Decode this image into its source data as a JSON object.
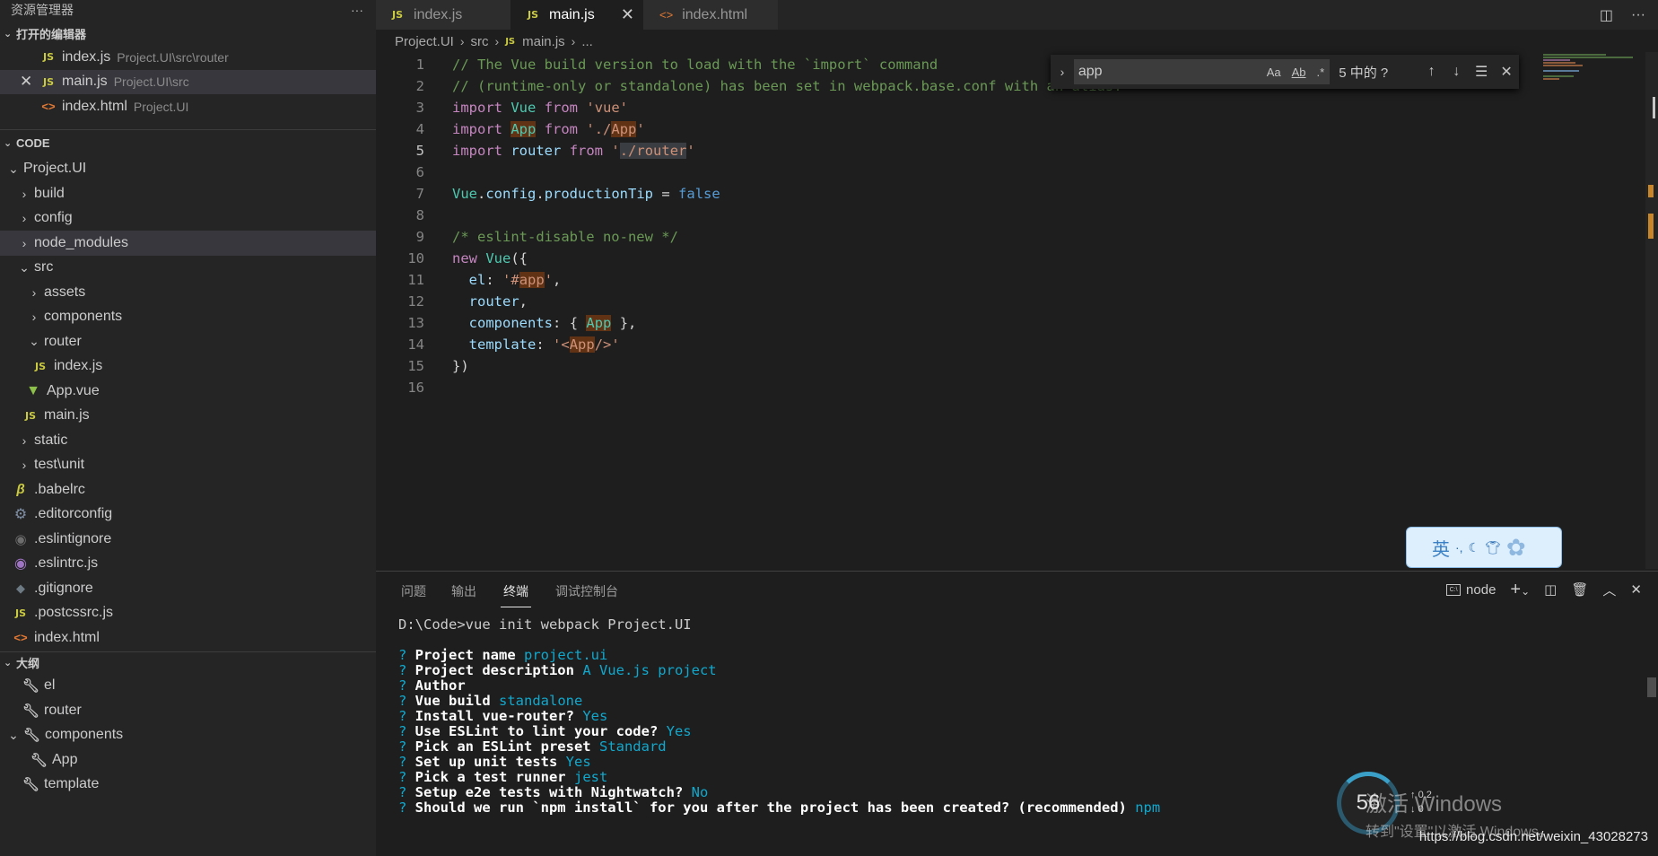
{
  "sidebar": {
    "title": "资源管理器",
    "more": "···",
    "open_editors": {
      "header": "打开的编辑器",
      "items": [
        {
          "icon": "js-file-icon",
          "name": "index.js",
          "path": "Project.UI\\src\\router"
        },
        {
          "icon": "js-file-icon",
          "name": "main.js",
          "path": "Project.UI\\src",
          "close": "✕"
        },
        {
          "icon": "html-file-icon",
          "name": "index.html",
          "path": "Project.UI"
        }
      ]
    },
    "workspace": {
      "header": "CODE",
      "root": "Project.UI",
      "tree": [
        {
          "name": "build"
        },
        {
          "name": "config"
        },
        {
          "name": "node_modules"
        },
        {
          "name": "src"
        },
        {
          "name": "assets"
        },
        {
          "name": "components"
        },
        {
          "name": "router"
        },
        {
          "name": "index.js"
        },
        {
          "name": "App.vue"
        },
        {
          "name": "main.js"
        },
        {
          "name": "static"
        },
        {
          "name": "test\\unit"
        },
        {
          "name": ".babelrc"
        },
        {
          "name": ".editorconfig"
        },
        {
          "name": ".eslintignore"
        },
        {
          "name": ".eslintrc.js"
        },
        {
          "name": ".gitignore"
        },
        {
          "name": ".postcssrc.js"
        },
        {
          "name": "index.html"
        }
      ]
    },
    "outline": {
      "header": "大纲",
      "items": [
        "el",
        "router",
        "components",
        "App",
        "template"
      ]
    }
  },
  "tabs": [
    {
      "label": "index.js",
      "icon": "js-file-icon",
      "active": false
    },
    {
      "label": "main.js",
      "icon": "js-file-icon",
      "active": true
    },
    {
      "label": "index.html",
      "icon": "html-file-icon",
      "active": false
    }
  ],
  "icon_labels": {
    "js": "JS",
    "html": "<>",
    "close": "✕"
  },
  "breadcrumb": [
    "Project.UI",
    "src",
    "main.js",
    "..."
  ],
  "find": {
    "query": "app",
    "count": "5 中的 ?",
    "opt_case": "Aa",
    "opt_word": "Ab",
    "opt_regex": ".*"
  },
  "code_lines": [
    "// The Vue build version to load with the `import` command",
    "// (runtime-only or standalone) has been set in webpack.base.conf with an alias.",
    "import Vue from 'vue'",
    "import App from './App'",
    "import router from './router'",
    "",
    "Vue.config.productionTip = false",
    "",
    "/* eslint-disable no-new */",
    "new Vue({",
    "  el: '#app',",
    "  router,",
    "  components: { App },",
    "  template: '<App/>'",
    "})",
    ""
  ],
  "line_numbers": [
    "1",
    "2",
    "3",
    "4",
    "5",
    "6",
    "7",
    "8",
    "9",
    "10",
    "11",
    "12",
    "13",
    "14",
    "15",
    "16"
  ],
  "panel": {
    "tabs": [
      "问题",
      "输出",
      "终端",
      "调试控制台"
    ],
    "active_tab": "终端",
    "terminal_name": "node",
    "terminal": {
      "command_line": "D:\\Code>vue init webpack Project.UI",
      "prompts": [
        {
          "q": "Project name",
          "a": "project.ui"
        },
        {
          "q": "Project description",
          "a": "A Vue.js project"
        },
        {
          "q": "Author",
          "a": ""
        },
        {
          "q": "Vue build",
          "a": "standalone"
        },
        {
          "q": "Install vue-router?",
          "a": "Yes"
        },
        {
          "q": "Use ESLint to lint your code?",
          "a": "Yes"
        },
        {
          "q": "Pick an ESLint preset",
          "a": "Standard"
        },
        {
          "q": "Set up unit tests",
          "a": "Yes"
        },
        {
          "q": "Pick a test runner",
          "a": "jest"
        },
        {
          "q": "Setup e2e tests with Nightwatch?",
          "a": "No"
        },
        {
          "q": "Should we run `npm install` for you after the project has been created? (recommended)",
          "a": "npm"
        }
      ]
    }
  },
  "ime": {
    "label": "英"
  },
  "net_widget": {
    "percent": "56",
    "up": "0.2",
    "down": "0"
  },
  "overlay": {
    "activate_title": "激活 Windows",
    "activate_sub": "转到\"设置\"以激活 Windows。",
    "watermark": "https://blog.csdn.net/weixin_43028273"
  },
  "colors": {
    "sidebar_bg": "#252526",
    "editor_bg": "#1e1e1e",
    "match_highlight": "#613214",
    "terminal_accent": "#11a8cd"
  }
}
